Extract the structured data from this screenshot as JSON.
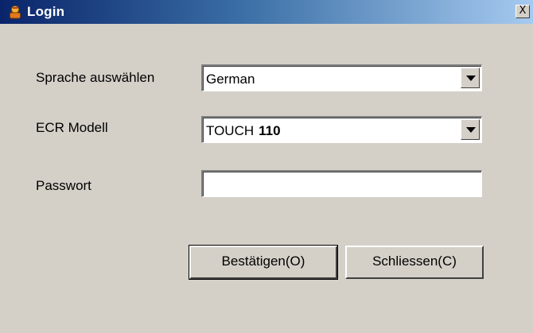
{
  "window": {
    "title": "Login",
    "close_label": "X"
  },
  "form": {
    "language": {
      "label": "Sprache auswählen",
      "value": "German"
    },
    "model": {
      "label": "ECR Modell",
      "value": "TOUCH",
      "value_suffix": "110"
    },
    "password": {
      "label": "Passwort",
      "value": ""
    }
  },
  "buttons": {
    "confirm_label": "Bestätigen(O)",
    "close_label": "Schliessen(C)"
  },
  "colors": {
    "titlebar_start": "#0a246a",
    "titlebar_end": "#a6caf0",
    "dialog_background": "#d4d0c8"
  },
  "icons": {
    "title": "login-person-icon",
    "combo": "chevron-down-icon"
  }
}
